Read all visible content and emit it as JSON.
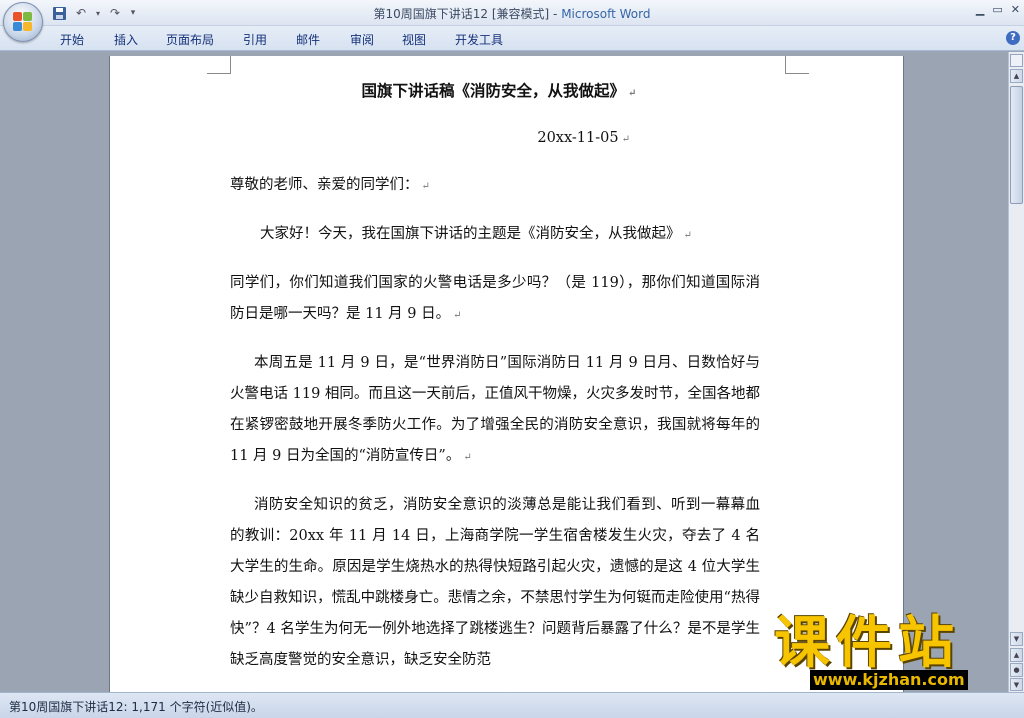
{
  "titlebar": {
    "doc_title": "第10周国旗下讲话12 [兼容模式]",
    "separator": " - ",
    "app_name": "Microsoft Word",
    "undo_icon": "undo-icon",
    "redo_icon": "redo-icon",
    "save_icon": "save-icon"
  },
  "ribbon": {
    "tabs": [
      "开始",
      "插入",
      "页面布局",
      "引用",
      "邮件",
      "审阅",
      "视图",
      "开发工具"
    ],
    "help_label": "?"
  },
  "document": {
    "title": "国旗下讲话稿《消防安全，从我做起》",
    "date": "20xx-11-05",
    "paragraphs": [
      "尊敬的老师、亲爱的同学们：",
      "大家好！今天，我在国旗下讲话的主题是《消防安全，从我做起》",
      "同学们，你们知道我们国家的火警电话是多少吗？（是 119），那你们知道国际消防日是哪一天吗？是 11 月 9 日。",
      "本周五是 11 月 9 日，是“世界消防日”国际消防日 11 月 9 日月、日数恰好与火警电话 119 相同。而且这一天前后，正值风干物燥，火灾多发时节，全国各地都在紧锣密鼓地开展冬季防火工作。为了增强全民的消防安全意识，我国就将每年的 11 月 9 日为全国的“消防宣传日”。",
      "消防安全知识的贫乏，消防安全意识的淡薄总是能让我们看到、听到一幕幕血的教训：20xx 年 11 月 14 日，上海商学院一学生宿舍楼发生火灾，夺去了 4 名大学生的生命。原因是学生烧热水的热得快短路引起火灾，遗憾的是这 4 位大学生缺少自救知识，慌乱中跳楼身亡。悲情之余，不禁思忖学生为何铤而走险使用“热得快”？4 名学生为何无一例外地选择了跳楼逃生？问题背后暴露了什么？是不是学生缺乏高度警觉的安全意识，缺乏安全防范"
    ],
    "pilcrow": "↵"
  },
  "statusbar": {
    "text": "第10周国旗下讲话12: 1,171 个字符(近似值)。"
  },
  "watermark": {
    "brand": "课件站",
    "url": "www.kjzhan.com"
  }
}
